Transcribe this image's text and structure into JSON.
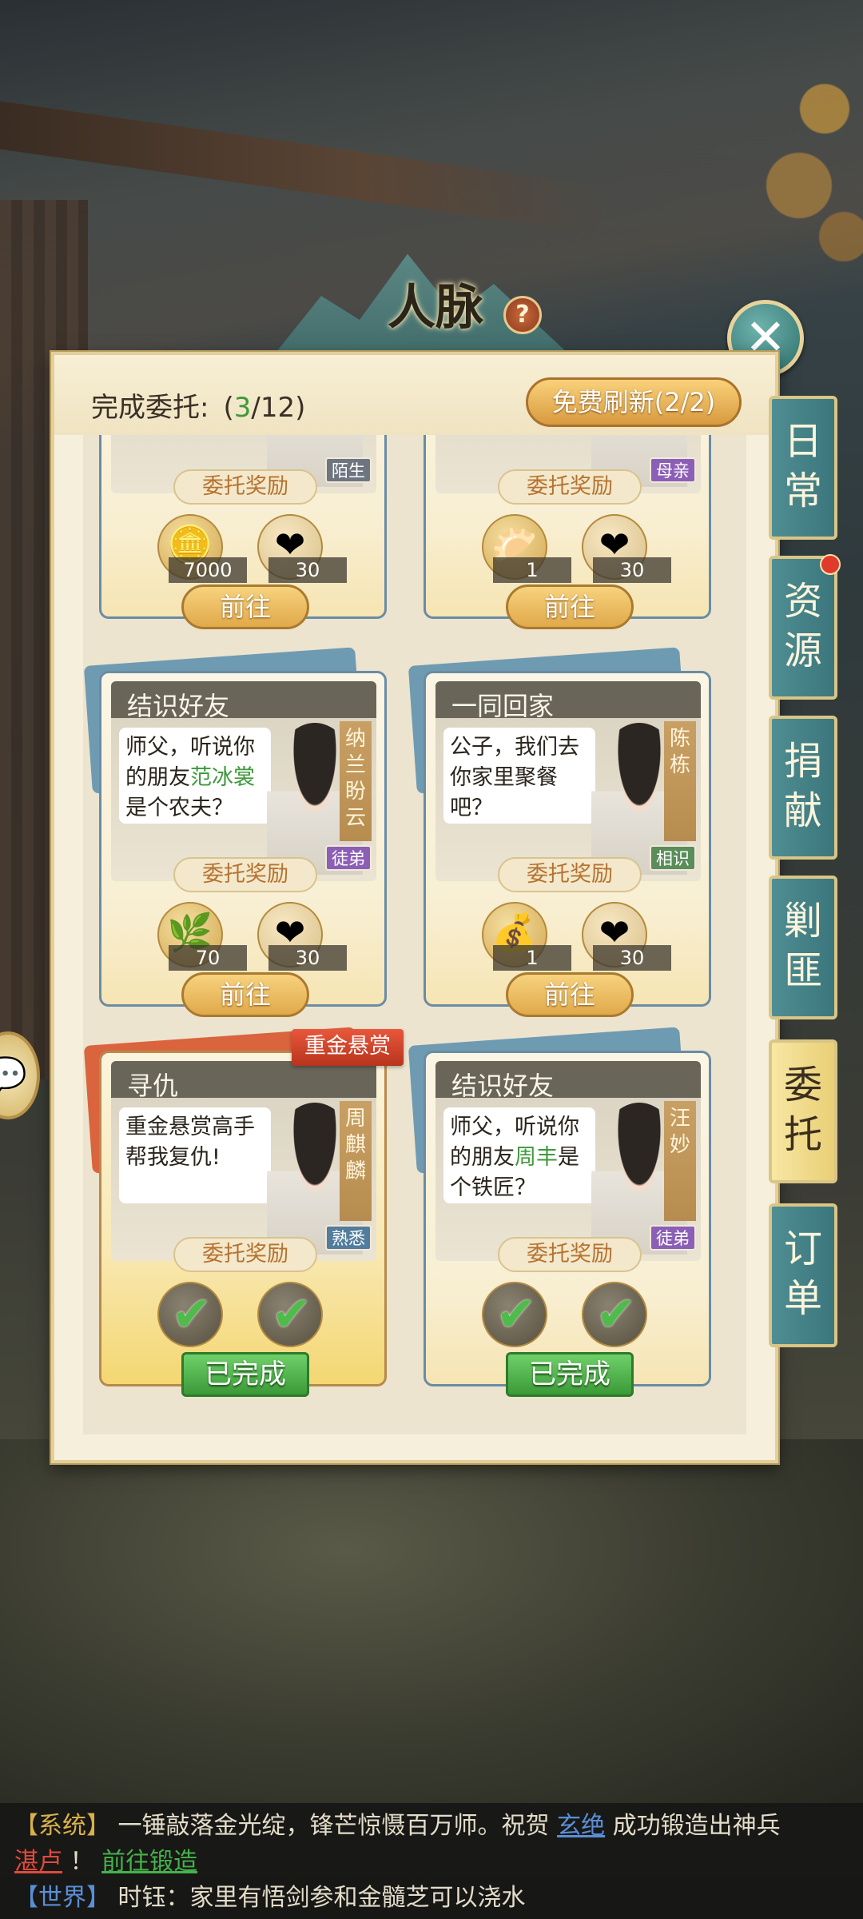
{
  "title": "人脉",
  "header": {
    "progress_label": "完成委托:",
    "progress_done": "3",
    "progress_total": "/12",
    "progress_open": "(",
    "progress_close": ")",
    "refresh_label": "免费刷新(2/2)"
  },
  "common": {
    "reward_label": "委托奖励",
    "go_label": "前往",
    "done_label": "已完成"
  },
  "cards": [
    {
      "title": "",
      "relation": "陌生",
      "items": [
        {
          "icon": "coins-icon",
          "count": "7000"
        },
        {
          "icon": "heart-icon",
          "count": "30"
        }
      ],
      "status": "go"
    },
    {
      "title": "",
      "relation": "母亲",
      "items": [
        {
          "icon": "dumplings-icon",
          "count": "1"
        },
        {
          "icon": "heart-icon",
          "count": "30"
        }
      ],
      "status": "go"
    },
    {
      "title": "结识好友",
      "speech_pre": "师父，听说你的朋友",
      "speech_hl": "范冰裳",
      "speech_post": "是个农夫？",
      "name": "纳兰盼云",
      "relation": "徒弟",
      "items": [
        {
          "icon": "herb-icon",
          "count": "70"
        },
        {
          "icon": "heart-icon",
          "count": "30"
        }
      ],
      "status": "go"
    },
    {
      "title": "一同回家",
      "speech_pre": "公子，我们去你家里聚餐吧？",
      "speech_hl": "",
      "speech_post": "",
      "name": "陈栋",
      "relation": "相识",
      "items": [
        {
          "icon": "money-bag-icon",
          "count": "1"
        },
        {
          "icon": "heart-icon",
          "count": "30"
        }
      ],
      "status": "go"
    },
    {
      "title": "寻仇",
      "ribbon": "重金悬赏",
      "speech_pre": "重金悬赏高手帮我复仇!",
      "speech_hl": "",
      "speech_post": "",
      "name": "周麒麟",
      "relation": "熟悉",
      "items": [
        {
          "icon": "item-icon",
          "count": ""
        },
        {
          "icon": "heart-icon",
          "count": ""
        }
      ],
      "status": "done"
    },
    {
      "title": "结识好友",
      "speech_pre": "师父，听说你的朋友",
      "speech_hl": "周丰",
      "speech_post": "是个铁匠？",
      "name": "汪妙",
      "relation": "徒弟",
      "items": [
        {
          "icon": "sack-icon",
          "count": ""
        },
        {
          "icon": "heart-icon",
          "count": ""
        }
      ],
      "status": "done"
    }
  ],
  "side_tabs": [
    {
      "label_1": "日",
      "label_2": "常"
    },
    {
      "label_1": "资",
      "label_2": "源"
    },
    {
      "label_1": "捐",
      "label_2": "献"
    },
    {
      "label_1": "剿",
      "label_2": "匪"
    },
    {
      "label_1": "委",
      "label_2": "托"
    },
    {
      "label_1": "订",
      "label_2": "单"
    }
  ],
  "chat": {
    "sys_tag": "【系统】",
    "sys_text_1": "一锤敲落金光绽，锋芒惊慑百万师。祝贺",
    "sys_player": "玄绝",
    "sys_text_2": "成功锻造出神兵",
    "sys_weapon": "湛卢",
    "sys_text_3": "！",
    "sys_link": "前往锻造",
    "world_tag": "【世界】",
    "world_text": "时钰：家里有悟剑参和金髓芝可以浇水"
  },
  "colors": {
    "accent_green": "#3e9a3b",
    "tab_teal": "#3b767c",
    "tab_active": "#e9cf76",
    "bounty_red": "#b8341e"
  }
}
